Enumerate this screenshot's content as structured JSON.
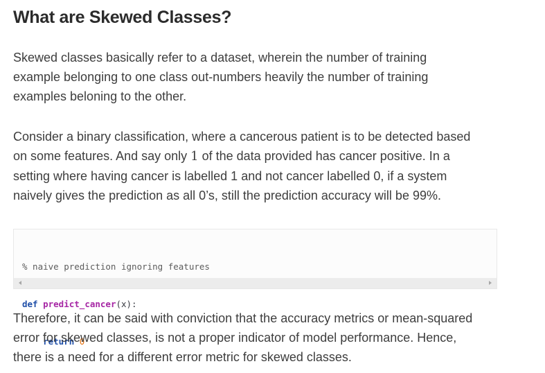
{
  "article": {
    "title": "What are Skewed Classes?",
    "paragraph1": [
      "Skewed classes basically refer to a dataset, wherein the number of training",
      "example belonging to one class out-numbers heavily the number of training",
      "examples beloning to the other."
    ],
    "paragraph2": {
      "line1": "Consider a binary classification, where a cancerous patient is to be detected based",
      "line2_before": "on some features. And say only ",
      "line2_number": "1",
      "line2_after": "  of the data provided has cancer positive. In a",
      "line3": "setting where having cancer is labelled 1 and not cancer labelled 0, if a system",
      "line4": "naively gives the prediction as all 0’s, still the prediction accuracy will be 99%."
    },
    "code": {
      "comment": "% naive prediction ignoring features",
      "def_keyword": "def",
      "function_name": "predict_cancer",
      "signature_rest": "(x):",
      "indent": "    ",
      "return_keyword": "return",
      "return_value": "0"
    },
    "paragraph3": [
      "Therefore, it can be said with conviction that the accuracy metrics or mean-squared",
      "error for skewed classes, is not a proper indicator of model performance. Hence,",
      "there is a need for a different error metric for skewed classes."
    ]
  },
  "icons": {
    "scroll_left": "chevron-left-icon",
    "scroll_right": "chevron-right-icon"
  },
  "colors": {
    "heading": "#2b2b2b",
    "body_text": "#3d3d3d",
    "code_keyword": "#1f4fa8",
    "code_function": "#a626a4",
    "code_number": "#e6700c",
    "code_background": "#fcfcfc",
    "scrollbar": "#ececec"
  }
}
